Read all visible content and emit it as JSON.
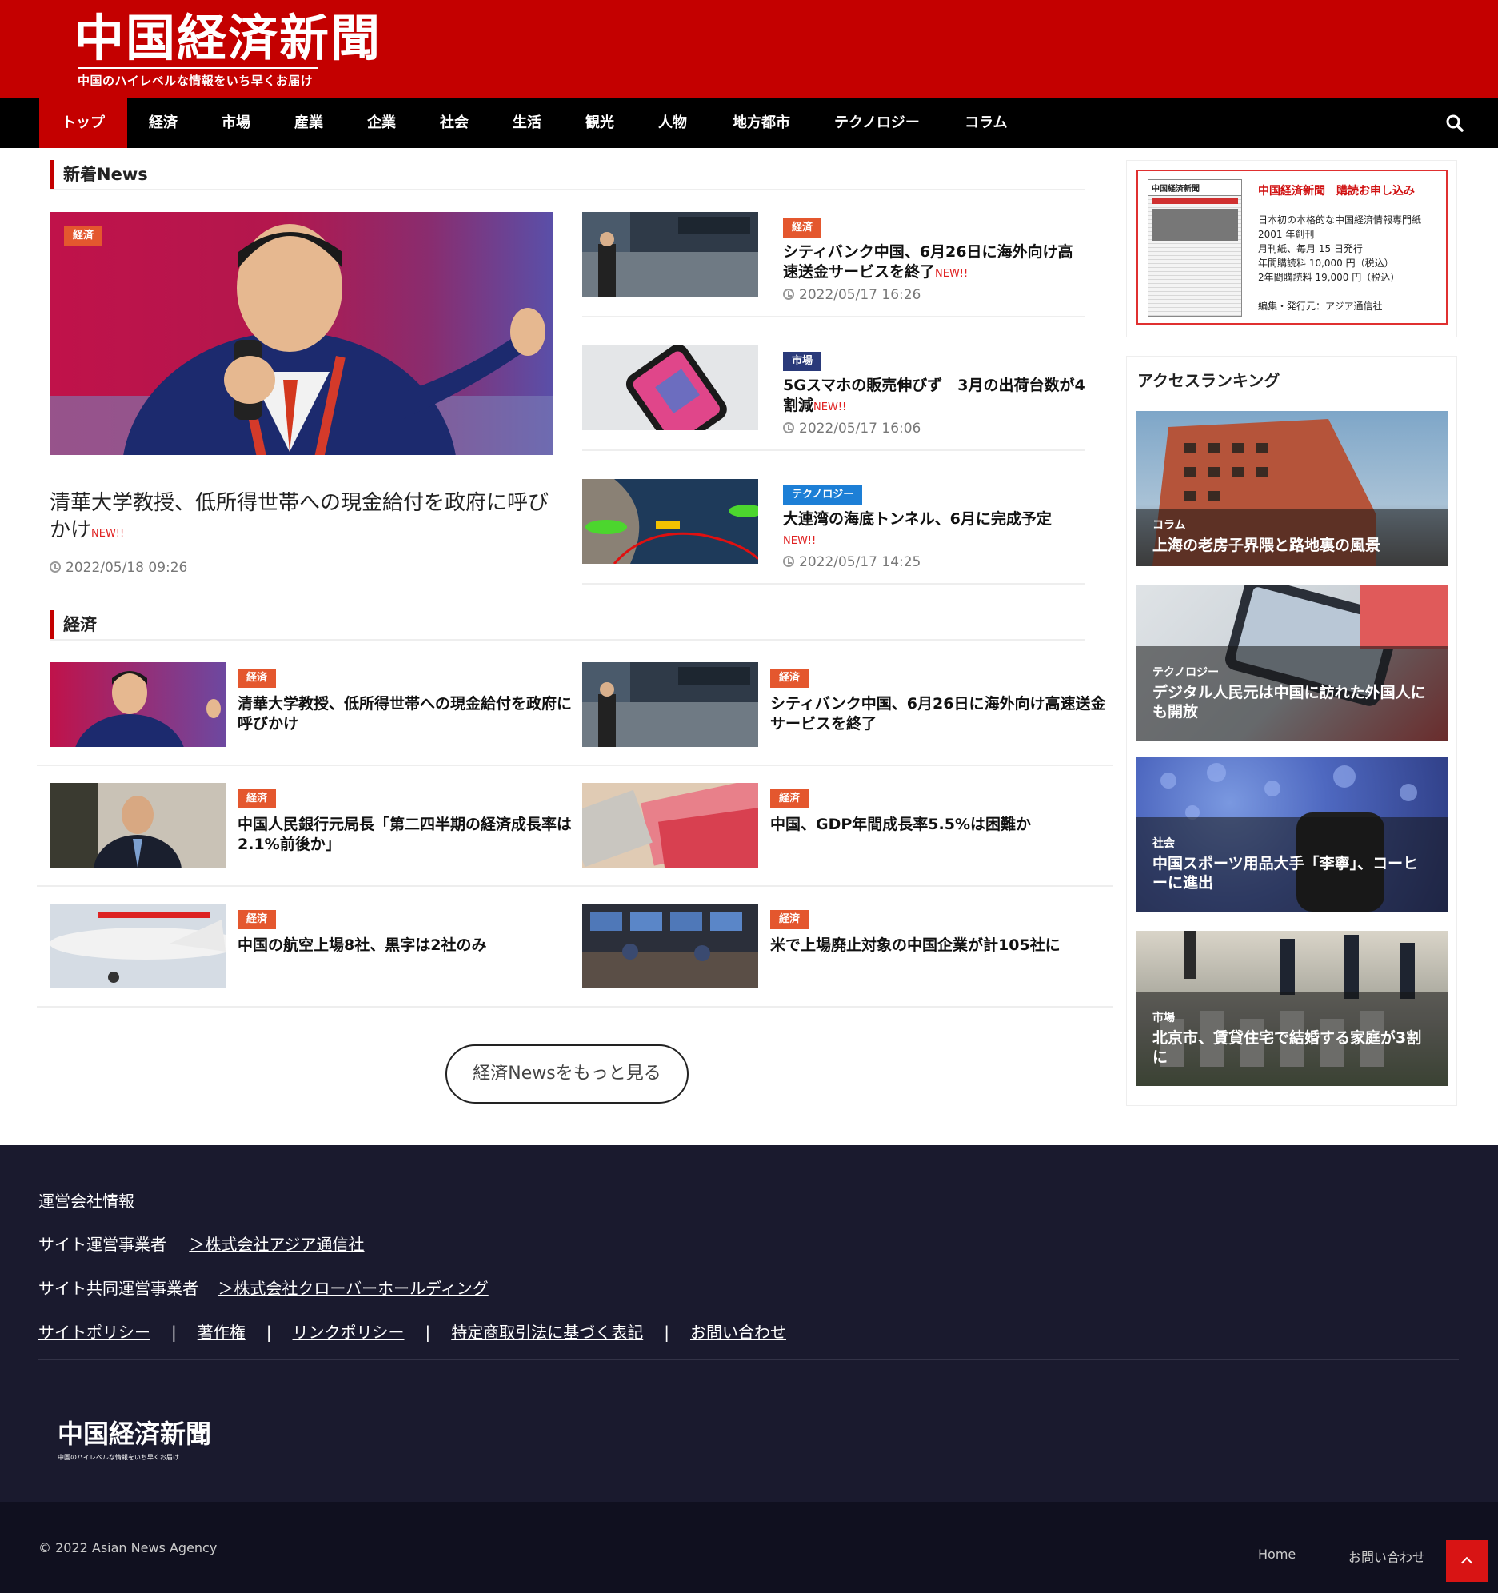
{
  "site": {
    "logo_main": "中国経済新聞",
    "logo_sub": "中国のハイレベルな情報をいち早くお届け"
  },
  "nav": {
    "items": [
      "トップ",
      "経済",
      "市場",
      "産業",
      "企業",
      "社会",
      "生活",
      "観光",
      "人物",
      "地方都市",
      "テクノロジー",
      "コラム"
    ],
    "search_icon": "search-icon"
  },
  "latest": {
    "heading": "新着News",
    "featured": {
      "tag": "経済",
      "title": "清華大学教授、低所得世帯への現金給付を政府に呼びかけ",
      "new_label": "NEW!!",
      "date": "2022/05/18 09:26"
    },
    "items": [
      {
        "tag": "経済",
        "title": "シティバンク中国、6月26日に海外向け高速送金サービスを終了",
        "new_label": "NEW!!",
        "date": "2022/05/17 16:26"
      },
      {
        "tag": "市場",
        "title": "5Gスマホの販売伸びず　3月の出荷台数が4割減",
        "new_label": "NEW!!",
        "date": "2022/05/17 16:06"
      },
      {
        "tag": "テクノロジー",
        "title": "大連湾の海底トンネル、6月に完成予定",
        "new_label": "NEW!!",
        "date": "2022/05/17 14:25"
      }
    ]
  },
  "economy": {
    "heading": "経済",
    "cards": [
      {
        "tag": "経済",
        "title": "清華大学教授、低所得世帯への現金給付を政府に呼びかけ"
      },
      {
        "tag": "経済",
        "title": "シティバンク中国、6月26日に海外向け高速送金サービスを終了"
      },
      {
        "tag": "経済",
        "title": "中国人民銀行元局長「第二四半期の経済成長率は2.1%前後か」"
      },
      {
        "tag": "経済",
        "title": "中国、GDP年間成長率5.5%は困難か"
      },
      {
        "tag": "経済",
        "title": "中国の航空上場8社、黒字は2社のみ"
      },
      {
        "tag": "経済",
        "title": "米で上場廃止対象の中国企業が計105社に"
      }
    ],
    "more_label": "経済Newsをもっと見る"
  },
  "sidebar": {
    "ad": {
      "paper_masthead": "中国経済新聞",
      "title": "中国経済新聞　購読お申し込み",
      "lines": [
        "日本初の本格的な中国経済情報専門紙",
        "2001 年創刊",
        "月刊紙、毎月 15 日発行",
        "年間購読料 10,000 円（税込）",
        "2年間購読料 19,000 円（税込）",
        "編集・発行元：アジア通信社"
      ]
    },
    "ranking_title": "アクセスランキング",
    "ranking": [
      {
        "category": "コラム",
        "title": "上海の老房子界隈と路地裏の風景"
      },
      {
        "category": "テクノロジー",
        "title": "デジタル人民元は中国に訪れた外国人にも開放"
      },
      {
        "category": "社会",
        "title": "中国スポーツ用品大手「李寧」、コーヒーに進出"
      },
      {
        "category": "市場",
        "title": "北京市、賃貸住宅で結婚する家庭が3割に"
      }
    ]
  },
  "footer": {
    "company_info": "運営会社情報",
    "operator_label": "サイト運営事業者",
    "operator_link": "＞株式会社アジア通信社",
    "co_operator_label": "サイト共同運営事業者",
    "co_operator_link": "＞株式会社クローバーホールディング",
    "links": [
      "サイトポリシー",
      "著作権",
      "リンクポリシー",
      "特定商取引法に基づく表記",
      "お問い合わせ"
    ],
    "separator": "|",
    "logo_main": "中国経済新聞",
    "logo_sub": "中国のハイレベルな情報をいち早くお届け",
    "copyright": "© 2022 Asian News Agency",
    "bottom_links": [
      "Home",
      "お問い合わせ"
    ]
  },
  "colors": {
    "brand_red": "#c40000",
    "nav_black": "#000000",
    "tag_red": "#e4572e",
    "tag_navy": "#2a3a7a",
    "tag_blue": "#1d7fd6",
    "footer_bg": "#1a1a2e"
  }
}
